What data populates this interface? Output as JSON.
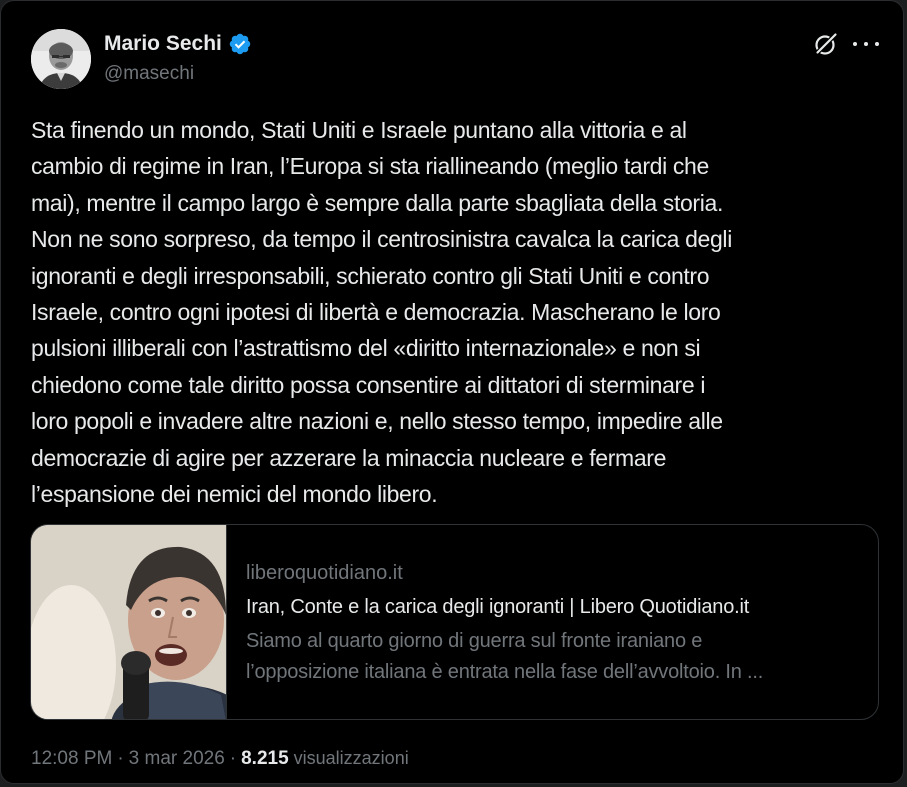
{
  "author": {
    "name": "Mario Sechi",
    "handle": "@masechi",
    "verified_color": "#1d9bf0"
  },
  "header_icons": [
    "grok-icon",
    "more-icon"
  ],
  "tweet": {
    "lines": [
      "Sta finendo un mondo, Stati Uniti e Israele puntano alla vittoria e al",
      "cambio di regime in Iran, l’Europa si sta riallineando (meglio tardi che",
      "mai), mentre il campo largo è sempre dalla parte sbagliata della storia.",
      "Non ne sono sorpreso, da tempo il centrosinistra cavalca la carica degli",
      "ignoranti e degli irresponsabili, schierato contro gli Stati Uniti e contro",
      "Israele, contro ogni ipotesi di libertà e democrazia. Mascherano le loro",
      "pulsioni illiberali con l’astrattismo del «diritto internazionale» e non si",
      "chiedono come tale diritto possa consentire ai dittatori di sterminare i",
      "loro popoli e invadere altre nazioni e, nello stesso tempo, impedire alle",
      "democrazie di agire per azzerare la minaccia nucleare e fermare",
      "l’espansione dei nemici del mondo libero."
    ]
  },
  "card": {
    "domain": "liberoquotidiano.it",
    "title": "Iran, Conte e la carica degli ignoranti | Libero Quotidiano.it",
    "desc_lines": [
      "Siamo al quarto giorno di guerra sul fronte iraniano e",
      "l’opposizione italiana è entrata nella fase dell’avvoltoio. In ..."
    ]
  },
  "meta": {
    "time": "12:08 PM",
    "separator": "·",
    "date": "3 mar 2026",
    "views_count": "8.215",
    "views_label": "visualizzazioni"
  },
  "colors": {
    "background": "#000000",
    "text": "#e7e9ea",
    "muted": "#71767b",
    "border": "#2f3336"
  }
}
